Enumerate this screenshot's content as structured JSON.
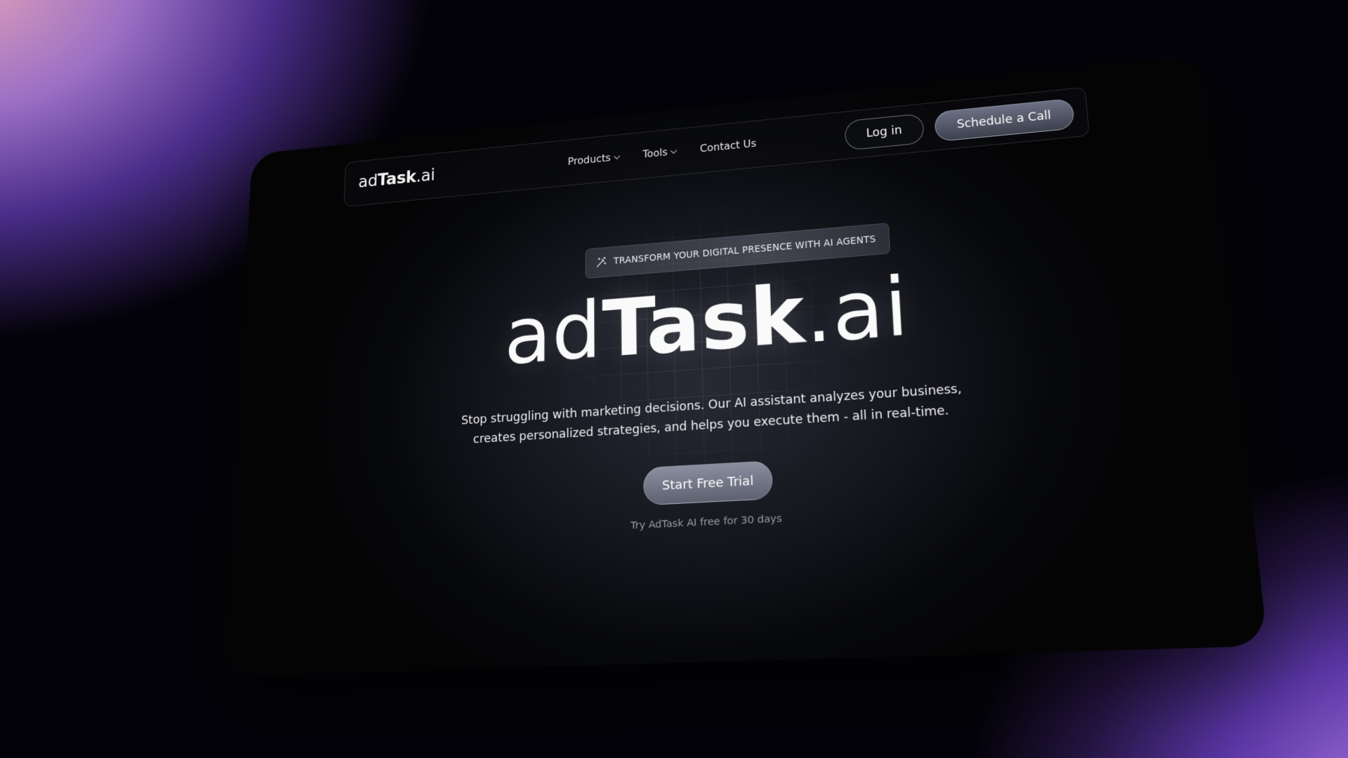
{
  "nav": {
    "logo_prefix": "ad",
    "logo_bold": "Task",
    "logo_suffix": ".ai",
    "links": [
      {
        "label": "Products",
        "has_dropdown": true
      },
      {
        "label": "Tools",
        "has_dropdown": true
      },
      {
        "label": "Contact Us",
        "has_dropdown": false
      }
    ],
    "login_label": "Log in",
    "cta_label": "Schedule a Call"
  },
  "hero": {
    "badge_icon": "magic-wand-icon",
    "badge_text": "TRANSFORM YOUR DIGITAL PRESENCE WITH AI AGENTS",
    "title_prefix": "ad",
    "title_bold": "Task",
    "title_suffix": ".ai",
    "description": "Stop struggling with marketing decisions. Our AI assistant analyzes your business, creates personalized strategies, and helps you execute them - all in real-time.",
    "cta_label": "Start Free Trial",
    "cta_note": "Try AdTask AI free for 30 days"
  },
  "colors": {
    "page_bg": "#030208",
    "card_bg": "#16181f",
    "accent_button": "#5d6170",
    "text": "#fafafa"
  }
}
